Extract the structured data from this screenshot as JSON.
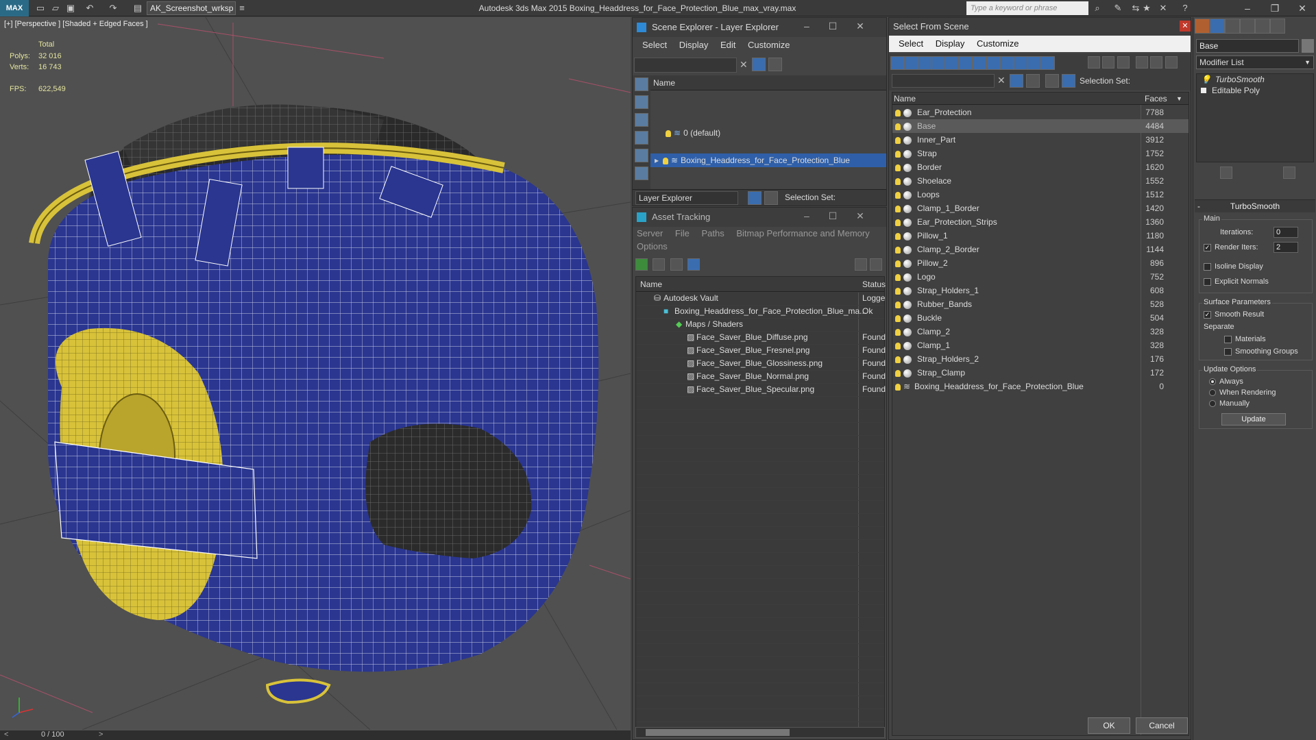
{
  "titlebar": {
    "logo": "MAX",
    "workspace": "AK_Screenshot_wrksp",
    "app_title": "Autodesk 3ds Max  2015     Boxing_Headdress_for_Face_Protection_Blue_max_vray.max",
    "search_placeholder": "Type a keyword or phrase"
  },
  "viewport": {
    "label": "[+] [Perspective ] [Shaded + Edged Faces ]",
    "stats": {
      "total_label": "Total",
      "polys_label": "Polys:",
      "polys_value": "32 016",
      "verts_label": "Verts:",
      "verts_value": "16 743",
      "fps_label": "FPS:",
      "fps_value": "622,549"
    },
    "timeline": "0 / 100",
    "colors": {
      "helmet_blue": "#2a3690",
      "helmet_yellow": "#d8c23a",
      "wire": "#ffffff"
    }
  },
  "scene_explorer": {
    "title": "Scene Explorer - Layer Explorer",
    "menu": [
      "Select",
      "Display",
      "Edit",
      "Customize"
    ],
    "col_name": "Name",
    "layers": [
      "0 (default)",
      "Boxing_Headdress_for_Face_Protection_Blue"
    ],
    "footer_label": "Layer Explorer",
    "selection_set": "Selection Set:"
  },
  "asset_tracking": {
    "title": "Asset Tracking",
    "menu": [
      "Server",
      "File",
      "Paths",
      "Bitmap Performance and Memory"
    ],
    "menu2": "Options",
    "col_name": "Name",
    "col_status": "Status",
    "rows": [
      {
        "name": "Autodesk Vault",
        "status": "Logge"
      },
      {
        "name": "Boxing_Headdress_for_Face_Protection_Blue_ma...",
        "status": "Ok"
      },
      {
        "name": "Maps / Shaders",
        "status": ""
      },
      {
        "name": "Face_Saver_Blue_Diffuse.png",
        "status": "Found"
      },
      {
        "name": "Face_Saver_Blue_Fresnel.png",
        "status": "Found"
      },
      {
        "name": "Face_Saver_Blue_Glossiness.png",
        "status": "Found"
      },
      {
        "name": "Face_Saver_Blue_Normal.png",
        "status": "Found"
      },
      {
        "name": "Face_Saver_Blue_Specular.png",
        "status": "Found"
      }
    ]
  },
  "select_from_scene": {
    "title": "Select From Scene",
    "menu": [
      "Select",
      "Display",
      "Customize"
    ],
    "selection_set": "Selection Set:",
    "col_name": "Name",
    "col_faces": "Faces",
    "rows": [
      {
        "name": "Ear_Protection",
        "faces": "7788"
      },
      {
        "name": "Base",
        "faces": "4484"
      },
      {
        "name": "Inner_Part",
        "faces": "3912"
      },
      {
        "name": "Strap",
        "faces": "1752"
      },
      {
        "name": "Border",
        "faces": "1620"
      },
      {
        "name": "Shoelace",
        "faces": "1552"
      },
      {
        "name": "Loops",
        "faces": "1512"
      },
      {
        "name": "Clamp_1_Border",
        "faces": "1420"
      },
      {
        "name": "Ear_Protection_Strips",
        "faces": "1360"
      },
      {
        "name": "Pillow_1",
        "faces": "1180"
      },
      {
        "name": "Clamp_2_Border",
        "faces": "1144"
      },
      {
        "name": "Pillow_2",
        "faces": "896"
      },
      {
        "name": "Logo",
        "faces": "752"
      },
      {
        "name": "Strap_Holders_1",
        "faces": "608"
      },
      {
        "name": "Rubber_Bands",
        "faces": "528"
      },
      {
        "name": "Buckle",
        "faces": "504"
      },
      {
        "name": "Clamp_2",
        "faces": "328"
      },
      {
        "name": "Clamp_1",
        "faces": "328"
      },
      {
        "name": "Strap_Holders_2",
        "faces": "176"
      },
      {
        "name": "Strap_Clamp",
        "faces": "172"
      },
      {
        "name": "Boxing_Headdress_for_Face_Protection_Blue",
        "faces": "0"
      }
    ],
    "ok": "OK",
    "cancel": "Cancel"
  },
  "modifier_panel": {
    "object_name": "Base",
    "modifier_list": "Modifier List",
    "stack": [
      "TurboSmooth",
      "Editable Poly"
    ],
    "rollout_title": "TurboSmooth",
    "main_group": "Main",
    "iterations_label": "Iterations:",
    "iterations_value": "0",
    "render_iters_label": "Render Iters:",
    "render_iters_value": "2",
    "isoline": "Isoline Display",
    "explicit_normals": "Explicit Normals",
    "surface_params": "Surface Parameters",
    "smooth_result": "Smooth Result",
    "separate": "Separate",
    "materials": "Materials",
    "smoothing_groups": "Smoothing Groups",
    "update_options": "Update Options",
    "always": "Always",
    "when_rendering": "When Rendering",
    "manually": "Manually",
    "update_btn": "Update"
  }
}
